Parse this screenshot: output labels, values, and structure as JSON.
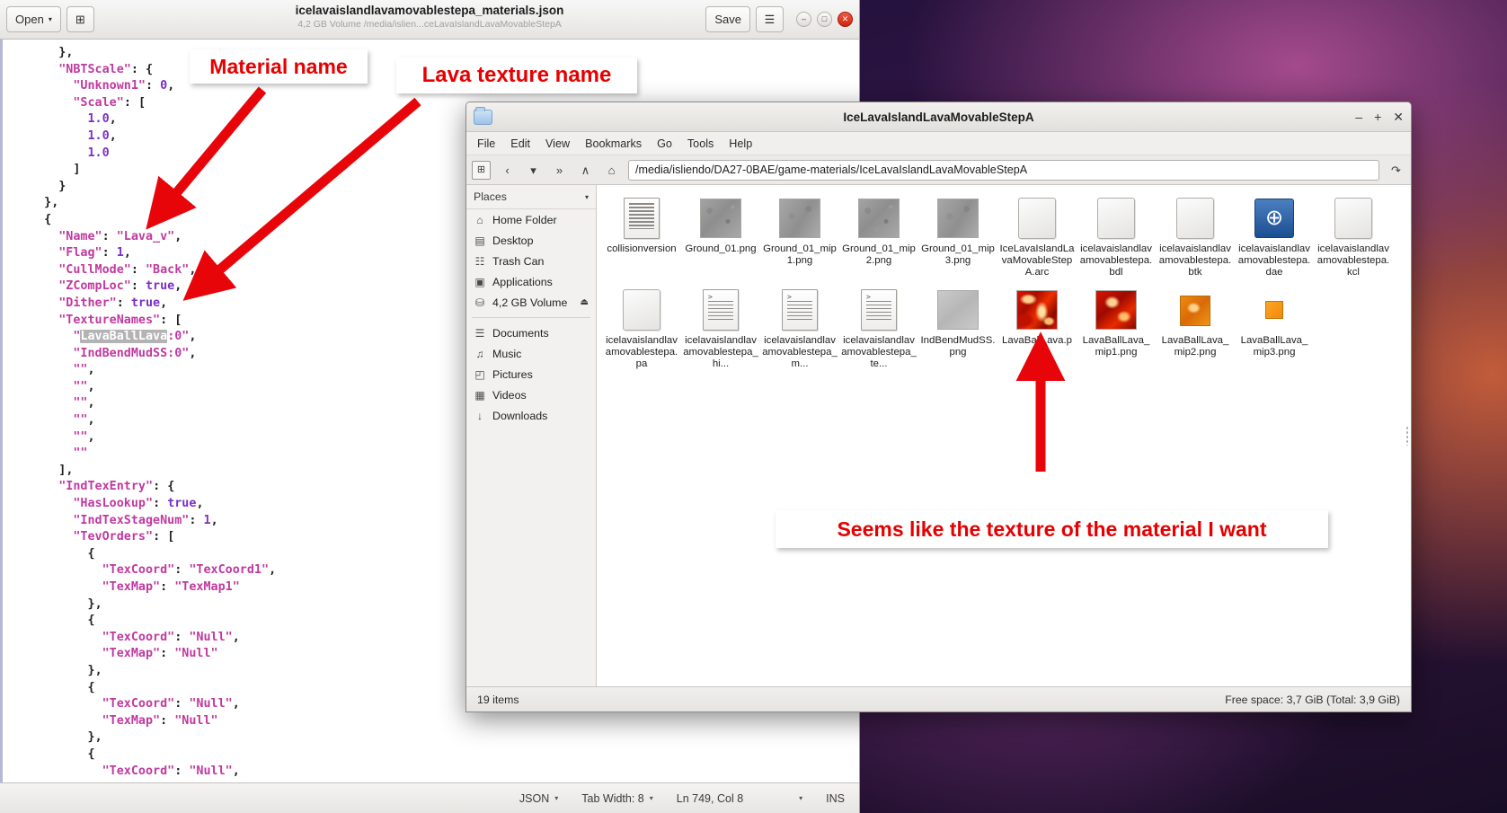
{
  "editor": {
    "window_title": "icelavaislandlavamovablestepa_materials.json",
    "window_subtitle": "4,2 GB Volume /media/islien...ceLavaIslandLavaMovableStepA",
    "open_button": "Open",
    "open_caret": "▾",
    "new_tab_icon": "⊞",
    "save_button": "Save",
    "menu_icon": "☰",
    "minimize_icon": "–",
    "maximize_icon": "□",
    "close_icon": "✕",
    "code": "    },\n    \"NBTScale\": {\n      \"Unknown1\": 0,\n      \"Scale\": [\n        1.0,\n        1.0,\n        1.0\n      ]\n    }\n  },\n  {\n    \"Name\": \"Lava_v\",\n    \"Flag\": 1,\n    \"CullMode\": \"Back\",\n    \"ZCompLoc\": true,\n    \"Dither\": true,\n    \"TextureNames\": [\n      \"LavaBallLava:0\",\n      \"IndBendMudSS:0\",\n      \"\",\n      \"\",\n      \"\",\n      \"\",\n      \"\",\n      \"\"\n    ],\n    \"IndTexEntry\": {\n      \"HasLookup\": true,\n      \"IndTexStageNum\": 1,\n      \"TevOrders\": [\n        {\n          \"TexCoord\": \"TexCoord1\",\n          \"TexMap\": \"TexMap1\"\n        },\n        {\n          \"TexCoord\": \"Null\",\n          \"TexMap\": \"Null\"\n        },\n        {\n          \"TexCoord\": \"Null\",\n          \"TexMap\": \"Null\"\n        },\n        {\n          \"TexCoord\": \"Null\",",
    "selected_text": "LavaBallLava",
    "statusbar": {
      "language": "JSON",
      "tab_width": "Tab Width: 8",
      "position": "Ln 749, Col 8",
      "insert_mode": "INS",
      "caret": "▾"
    }
  },
  "filemanager": {
    "window_title": "IceLavaIslandLavaMovableStepA",
    "folder_icon": "folder-icon",
    "minimize_icon": "–",
    "maximize_icon": "+",
    "close_icon": "✕",
    "menu": [
      "File",
      "Edit",
      "View",
      "Bookmarks",
      "Go",
      "Tools",
      "Help"
    ],
    "toolbar": {
      "new_tab_icon": "⊞",
      "back_icon": "‹",
      "history_icon": "▾",
      "forward_icon": "»",
      "up_icon": "∧",
      "home_icon": "⌂",
      "refresh_icon": "↷"
    },
    "path": "/media/isliendo/DA27-0BAE/game-materials/IceLavaIslandLavaMovableStepA",
    "sidebar": {
      "header": "Places",
      "header_caret": "▾",
      "items": [
        {
          "label": "Home Folder",
          "icon": "⌂",
          "eject": ""
        },
        {
          "label": "Desktop",
          "icon": "▤",
          "eject": ""
        },
        {
          "label": "Trash Can",
          "icon": "☷",
          "eject": ""
        },
        {
          "label": "Applications",
          "icon": "▣",
          "eject": ""
        },
        {
          "label": "4,2 GB Volume",
          "icon": "⛁",
          "eject": "⏏"
        }
      ],
      "items2": [
        {
          "label": "Documents",
          "icon": "☰",
          "eject": ""
        },
        {
          "label": "Music",
          "icon": "♫",
          "eject": ""
        },
        {
          "label": "Pictures",
          "icon": "◰",
          "eject": ""
        },
        {
          "label": "Videos",
          "icon": "▦",
          "eject": ""
        },
        {
          "label": "Downloads",
          "icon": "↓",
          "eject": ""
        }
      ]
    },
    "files": [
      {
        "name": "collisionversion",
        "thumb": "doc"
      },
      {
        "name": "Ground_01.png",
        "thumb": "ground"
      },
      {
        "name": "Ground_01_mip1.png",
        "thumb": "ground2"
      },
      {
        "name": "Ground_01_mip2.png",
        "thumb": "ground"
      },
      {
        "name": "Ground_01_mip3.png",
        "thumb": "ground2"
      },
      {
        "name": "IceLavaIslandLavaMovableStepA.arc",
        "thumb": "plain"
      },
      {
        "name": "icelavaislandlavamovablestepa.bdl",
        "thumb": "plain"
      },
      {
        "name": "icelavaislandlavamovablestepa.btk",
        "thumb": "plain"
      },
      {
        "name": "icelavaislandlavamovablestepa.dae",
        "thumb": "globe"
      },
      {
        "name": "icelavaislandlavamovablestepa.kcl",
        "thumb": "plain"
      },
      {
        "name": "icelavaislandlavamovablestepa.pa",
        "thumb": "plain"
      },
      {
        "name": "icelavaislandlavamovablestepa_hi...",
        "thumb": "code"
      },
      {
        "name": "icelavaislandlavamovablestepa_m...",
        "thumb": "code"
      },
      {
        "name": "icelavaislandlavamovablestepa_te...",
        "thumb": "code"
      },
      {
        "name": "IndBendMudSS.png",
        "thumb": "mud"
      },
      {
        "name": "LavaBallLava.png",
        "thumb": "lava"
      },
      {
        "name": "LavaBallLava_mip1.png",
        "thumb": "lava2"
      },
      {
        "name": "LavaBallLava_mip2.png",
        "thumb": "lava3"
      },
      {
        "name": "LavaBallLava_mip3.png",
        "thumb": "lava4"
      }
    ],
    "status_items": "19 items",
    "status_freespace": "Free space: 3,7 GiB (Total: 3,9 GiB)"
  },
  "annotations": {
    "material_name": "Material name",
    "texture_name": "Lava texture name",
    "seems_like": "Seems like the texture of the material I want",
    "arrow_color": "#e8050a"
  }
}
